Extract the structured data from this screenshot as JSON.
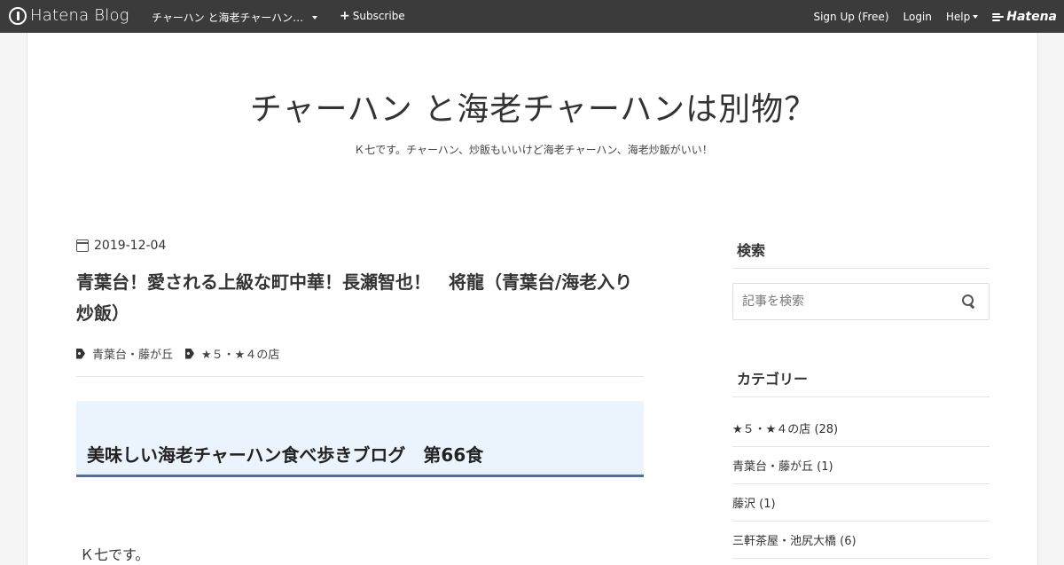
{
  "topbar": {
    "logo_text": "Hatena Blog",
    "blog_name": "チャーハン と海老チャーハン…",
    "subscribe_label": "Subscribe",
    "signup_label": "Sign Up (Free)",
    "login_label": "Login",
    "help_label": "Help",
    "hatena_label": "Hatena"
  },
  "header": {
    "title": "チャーハン と海老チャーハンは別物？",
    "description": "Ｋ七です。チャーハン、炒飯もいいけど海老チャーハン、海老炒飯がいい！"
  },
  "article": {
    "date": "2019-12-04",
    "title": "青葉台！愛される上級な町中華！長瀬智也！　将龍（青葉台/海老入り炒飯）",
    "categories": [
      "青葉台・藤が丘",
      "★５・★４の店"
    ],
    "section_heading": "美味しい海老チャーハン食べ歩きブログ　第66食",
    "body_first_line": "Ｋ七です。"
  },
  "sidebar": {
    "search_title": "検索",
    "search_placeholder": "記事を検索",
    "category_title": "カテゴリー",
    "categories": [
      {
        "label": "★５・★４の店 (28)"
      },
      {
        "label": "青葉台・藤が丘 (1)"
      },
      {
        "label": "藤沢 (1)"
      },
      {
        "label": "三軒茶屋・池尻大橋 (6)"
      }
    ]
  },
  "colors": {
    "topbar_bg": "#3b3b3b",
    "section_bg": "#ebf3fc",
    "section_border": "#4e6eab"
  }
}
